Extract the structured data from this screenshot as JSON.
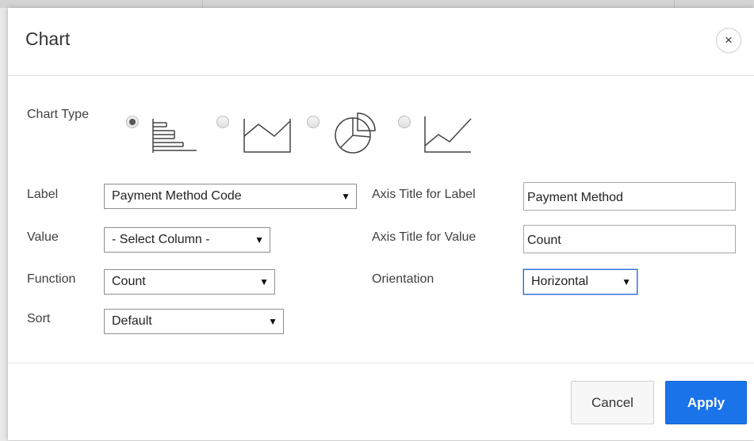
{
  "dialog": {
    "title": "Chart",
    "close_symbol": "×"
  },
  "chart_type": {
    "label": "Chart Type",
    "options": [
      {
        "name": "bar",
        "icon": "bar-chart-icon",
        "selected": true
      },
      {
        "name": "area",
        "icon": "area-chart-icon",
        "selected": false
      },
      {
        "name": "pie",
        "icon": "pie-chart-icon",
        "selected": false
      },
      {
        "name": "line",
        "icon": "line-chart-icon",
        "selected": false
      }
    ]
  },
  "fields": {
    "label": {
      "label": "Label",
      "value": "Payment Method Code"
    },
    "value": {
      "label": "Value",
      "value": "- Select Column -"
    },
    "function": {
      "label": "Function",
      "value": "Count"
    },
    "sort": {
      "label": "Sort",
      "value": "Default"
    },
    "axis_title_label": {
      "label": "Axis Title for Label",
      "value": "Payment Method"
    },
    "axis_title_value": {
      "label": "Axis Title for Value",
      "value": "Count"
    },
    "orientation": {
      "label": "Orientation",
      "value": "Horizontal"
    }
  },
  "dropdown_arrow": "▼",
  "footer": {
    "cancel_label": "Cancel",
    "apply_label": "Apply"
  },
  "colors": {
    "apply_button": "#1a73e8",
    "focus_border": "#2b6ad8"
  }
}
